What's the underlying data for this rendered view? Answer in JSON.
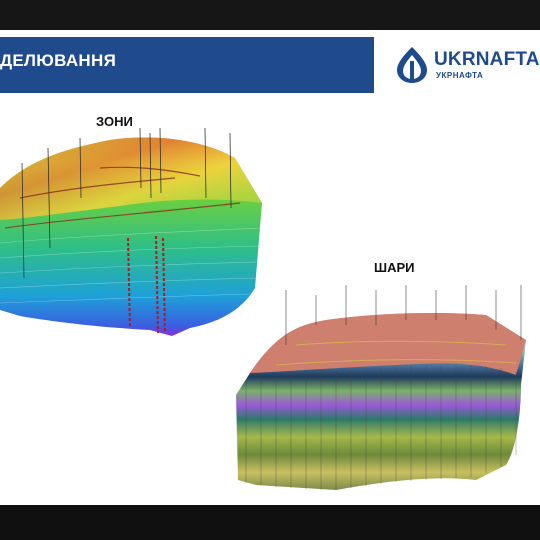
{
  "slide": {
    "title": "ДЕЛЮВАННЯ",
    "logo": {
      "name": "UKRNAFTA",
      "subtitle": "УКРНАФТА",
      "brand_color": "#1f4a8c"
    },
    "figures": [
      {
        "label": "ЗОНИ",
        "icon": "zones-3d-model"
      },
      {
        "label": "ШАРИ",
        "icon": "layers-3d-model"
      }
    ]
  }
}
